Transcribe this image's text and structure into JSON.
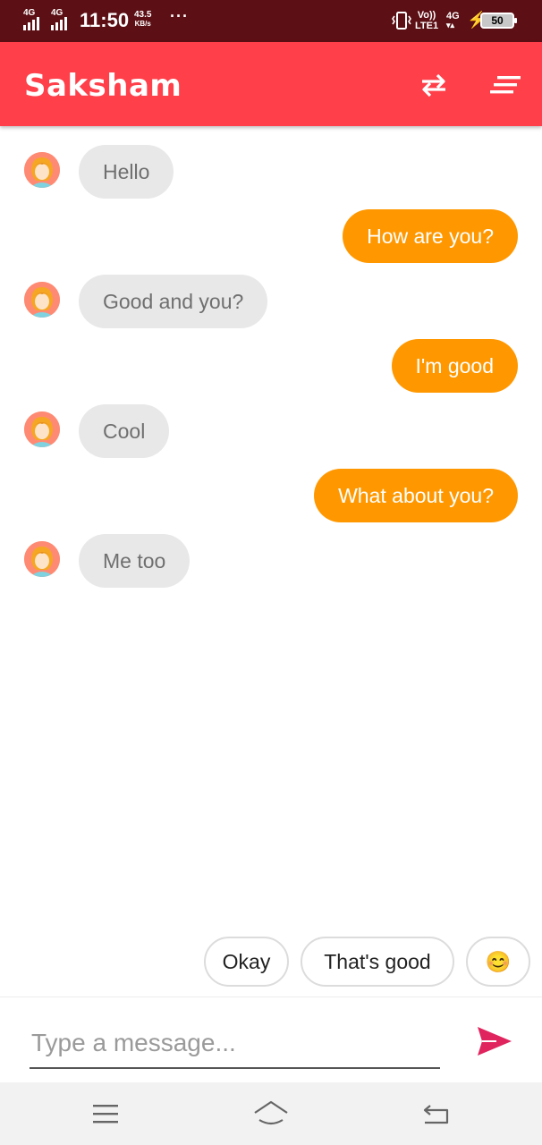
{
  "status_bar": {
    "sim1_network": "4G",
    "sim2_network": "4G",
    "time": "11:50",
    "speed_value": "43.5",
    "speed_unit": "KB/s",
    "more_indicator": "···",
    "volte_top": "Vo))",
    "volte_bottom": "LTE1",
    "data_network": "4G",
    "battery_level": "50"
  },
  "app_bar": {
    "title": "Saksham",
    "swap_icon": "swap-arrows-icon",
    "menu_icon": "sort-menu-icon"
  },
  "messages": [
    {
      "sender": "bot",
      "text": "Hello"
    },
    {
      "sender": "user",
      "text": "How are you?"
    },
    {
      "sender": "bot",
      "text": "Good and you?"
    },
    {
      "sender": "user",
      "text": "I'm good"
    },
    {
      "sender": "bot",
      "text": "Cool"
    },
    {
      "sender": "user",
      "text": "What about you?"
    },
    {
      "sender": "bot",
      "text": "Me too"
    }
  ],
  "suggestions": [
    "Okay",
    "That's good",
    "😊"
  ],
  "input": {
    "placeholder": "Type a message...",
    "value": ""
  },
  "colors": {
    "status_bar": "#5c0f14",
    "app_bar": "#ff3f4a",
    "user_bubble": "#ff9800",
    "bot_bubble": "#e8e8e8",
    "send_icon": "#e0245e"
  },
  "nav_bar": {
    "icons": [
      "menu-icon",
      "home-icon",
      "back-icon"
    ]
  }
}
